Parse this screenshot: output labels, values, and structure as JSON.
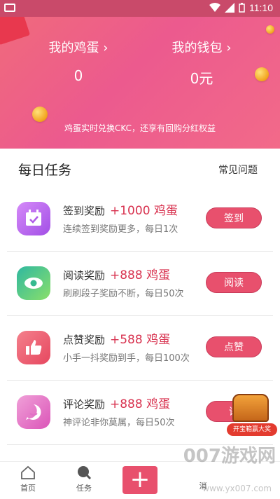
{
  "status_bar": {
    "time": "11:10"
  },
  "hero": {
    "eggs_label": "我的鸡蛋 ›",
    "eggs_value": "0",
    "wallet_label": "我的钱包 ›",
    "wallet_value": "0元",
    "subtitle": "鸡蛋实时兑换CKC，还享有回购分红权益"
  },
  "section": {
    "title": "每日任务",
    "faq_link": "常见问题"
  },
  "tasks": [
    {
      "name": "签到奖励",
      "reward": "+1000 鸡蛋",
      "desc": "连续签到奖励更多，每日1次",
      "button": "签到",
      "icon": "calendar-icon",
      "color": "#b85cf0"
    },
    {
      "name": "阅读奖励",
      "reward": "+888 鸡蛋",
      "desc": "刷刷段子奖励不断，每日50次",
      "button": "阅读",
      "icon": "eye-icon",
      "color": "#32c28f"
    },
    {
      "name": "点赞奖励",
      "reward": "+588 鸡蛋",
      "desc": "小手一抖奖励到手，每日100次",
      "button": "点赞",
      "icon": "thumbs-up-icon",
      "color": "#f0607a"
    },
    {
      "name": "评论奖励",
      "reward": "+888 鸡蛋",
      "desc": "神评论非你莫属，每日50次",
      "button": "评",
      "icon": "comment-icon",
      "color": "#e86cc8"
    }
  ],
  "treasure": {
    "label": "开宝箱赢大奖"
  },
  "bottom_nav": {
    "home": "首页",
    "tasks": "任务",
    "plus": "+",
    "partial": "消"
  },
  "watermark": {
    "main": "007游戏网",
    "sub": "www.yx007.com"
  }
}
